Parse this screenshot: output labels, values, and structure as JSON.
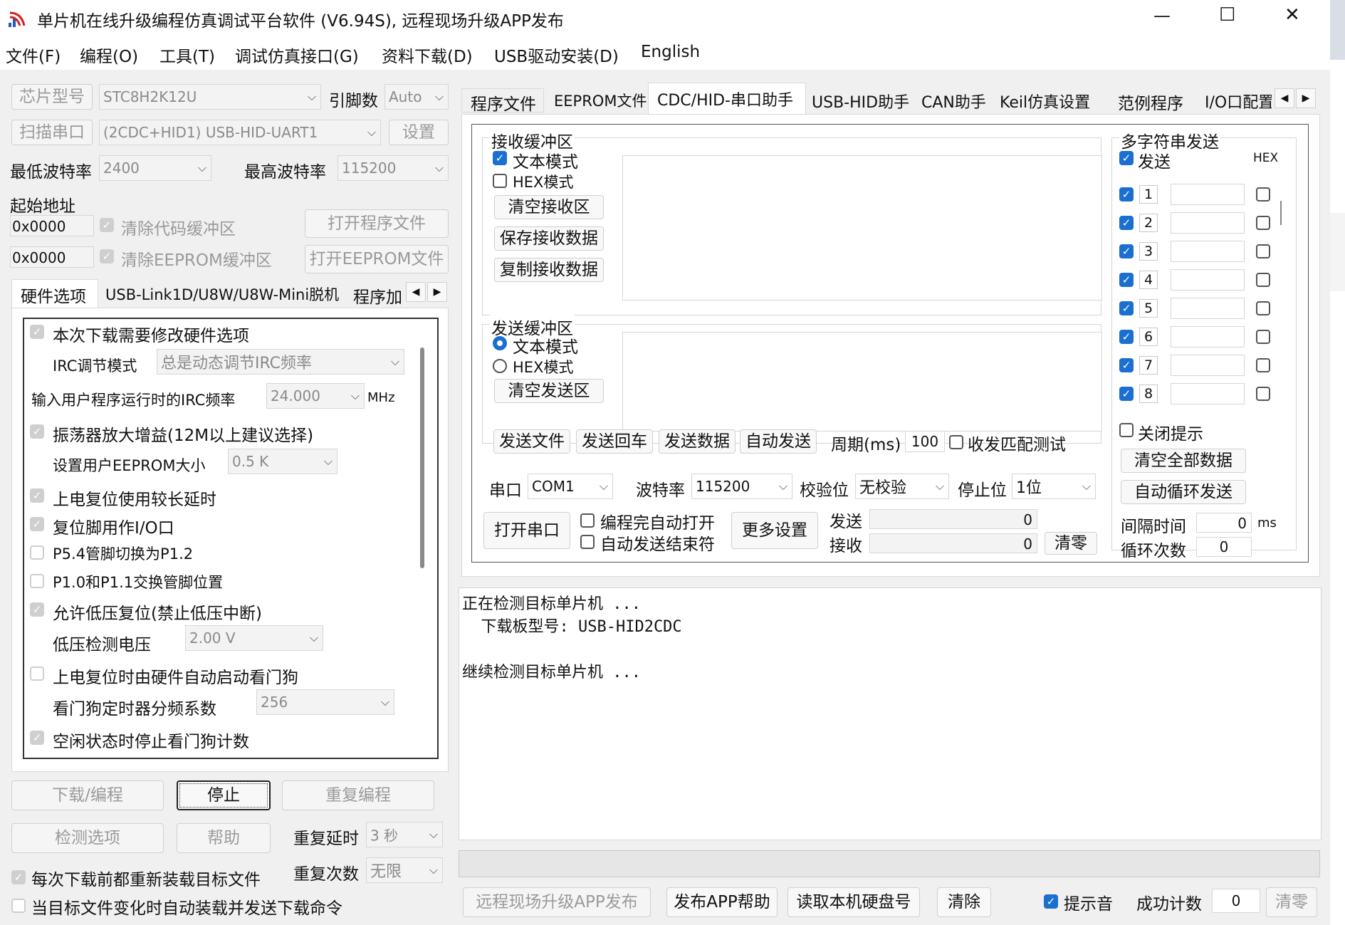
{
  "title": "单片机在线升级编程仿真调试平台软件 (V6.94S), 远程现场升级APP发布",
  "window_controls": {
    "minimize": "—",
    "maximize": "☐",
    "close": "✕"
  },
  "menu": [
    "文件(F)",
    "编程(O)",
    "工具(T)",
    "调试仿真接口(G)",
    "资料下载(D)",
    "USB驱动安装(D)",
    "English"
  ],
  "left": {
    "chip_label": "芯片型号",
    "chip_value": "STC8H2K12U",
    "pins_label": "引脚数",
    "pins_value": "Auto",
    "scan_label": "扫描串口",
    "port_value": "(2CDC+HID1) USB-HID-UART1",
    "settings_button": "设置",
    "min_baud_label": "最低波特率",
    "min_baud_value": "2400",
    "max_baud_label": "最高波特率",
    "max_baud_value": "115200",
    "start_addr_label": "起始地址",
    "addr1": "0x0000",
    "addr2": "0x0000",
    "clear_code": "清除代码缓冲区",
    "clear_eeprom": "清除EEPROM缓冲区",
    "open_program": "打开程序文件",
    "open_eeprom": "打开EEPROM文件",
    "tabs": [
      "硬件选项",
      "USB-Link1D/U8W/U8W-Mini脱机",
      "程序加"
    ],
    "hw": {
      "modify_hw": "本次下载需要修改硬件选项",
      "irc_mode_label": "IRC调节模式",
      "irc_mode_value": "总是动态调节IRC频率",
      "irc_freq_label": "输入用户程序运行时的IRC频率",
      "irc_freq_value": "24.000",
      "mhz": "MHz",
      "osc_gain": "振荡器放大增益(12M以上建议选择)",
      "eeprom_size_label": "设置用户EEPROM大小",
      "eeprom_size_value": "0.5 K",
      "power_delay": "上电复位使用较长延时",
      "reset_io": "复位脚用作I/O口",
      "p54": "P5.4管脚切换为P1.2",
      "p10": "P1.0和P1.1交换管脚位置",
      "lvd_reset": "允许低压复位(禁止低压中断)",
      "lvd_label": "低压检测电压",
      "lvd_value": "2.00 V",
      "wdt_auto": "上电复位时由硬件自动启动看门狗",
      "wdt_div_label": "看门狗定时器分频系数",
      "wdt_div_value": "256",
      "wdt_idle": "空闲状态时停止看门狗计数"
    },
    "download_btn": "下载/编程",
    "stop_btn": "停止",
    "repeat_btn": "重复编程",
    "check_btn": "检测选项",
    "help_btn": "帮助",
    "repeat_delay_label": "重复延时",
    "repeat_delay_value": "3 秒",
    "repeat_count_label": "重复次数",
    "repeat_count_value": "无限",
    "reload_each": "每次下载前都重新装载目标文件",
    "auto_reload": "当目标文件变化时自动装载并发送下载命令"
  },
  "right": {
    "tabs": [
      "程序文件",
      "EEPROM文件",
      "CDC/HID-串口助手",
      "USB-HID助手",
      "CAN助手",
      "Keil仿真设置",
      "范例程序",
      "I/O口配置"
    ],
    "recv_group": "接收缓冲区",
    "text_mode": "文本模式",
    "hex_mode": "HEX模式",
    "clear_recv": "清空接收区",
    "save_recv": "保存接收数据",
    "copy_recv": "复制接收数据",
    "send_group": "发送缓冲区",
    "clear_send": "清空发送区",
    "send_file": "发送文件",
    "send_enter": "发送回车",
    "send_data": "发送数据",
    "auto_send": "自动发送",
    "period_label": "周期(ms)",
    "period_value": "100",
    "loop_test": "收发匹配测试",
    "port_label": "串口",
    "port_value": "COM1",
    "baud_label": "波特率",
    "baud_value": "115200",
    "parity_label": "校验位",
    "parity_value": "无校验",
    "stop_label": "停止位",
    "stop_value": "1位",
    "open_port": "打开串口",
    "auto_open": "编程完自动打开",
    "auto_send_end": "自动发送结束符",
    "more_settings": "更多设置",
    "send_label": "发送",
    "send_count": "0",
    "recv_label": "接收",
    "recv_count": "0",
    "clear_counts": "清零",
    "multi_group": "多字符串发送",
    "multi_send": "发送",
    "hex": "HEX",
    "rows": [
      "1",
      "2",
      "3",
      "4",
      "5",
      "6",
      "7",
      "8"
    ],
    "close_tip": "关闭提示",
    "clear_all": "清空全部数据",
    "auto_loop": "自动循环发送",
    "interval_label": "间隔时间",
    "interval_value": "0",
    "interval_unit": "ms",
    "loop_count_label": "循环次数",
    "loop_count_value": "0"
  },
  "log": [
    "正在检测目标单片机 ...",
    "  下载板型号: USB-HID2CDC",
    "",
    "继续检测目标单片机 ..."
  ],
  "bottom": {
    "remote_upgrade": "远程现场升级APP发布",
    "publish_help": "发布APP帮助",
    "read_disk": "读取本机硬盘号",
    "clear": "清除",
    "beep": "提示音",
    "success_label": "成功计数",
    "success_value": "0",
    "reset": "清零"
  },
  "colors": {
    "accent": "#1a6fd0",
    "window_bg": "#f0f0f0",
    "panel_bg": "#ffffff",
    "disabled_text": "#9a9a9a"
  }
}
